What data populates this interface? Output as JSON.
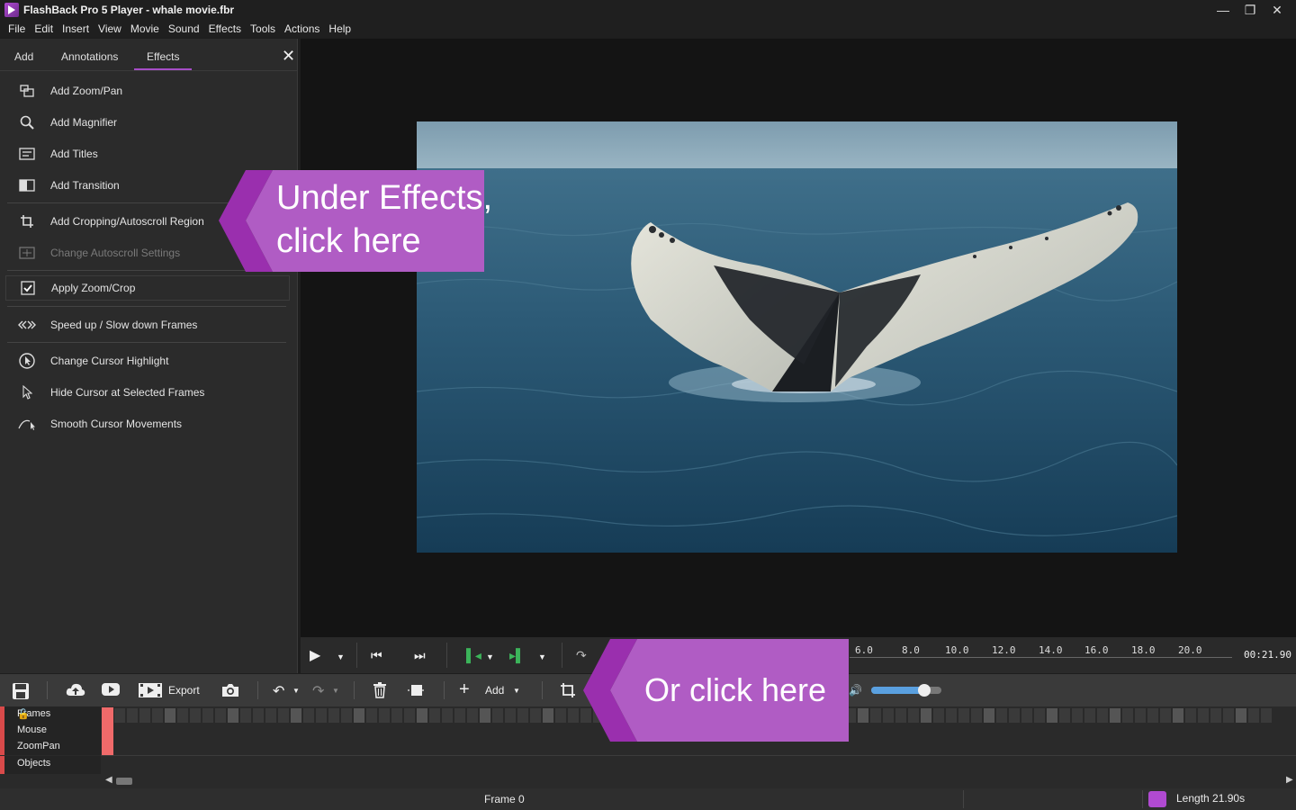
{
  "window": {
    "title": "FlashBack Pro 5 Player - whale movie.fbr",
    "minimize_glyph": "—",
    "restore_glyph": "❐",
    "close_glyph": "✕"
  },
  "menu": [
    "File",
    "Edit",
    "Insert",
    "View",
    "Movie",
    "Sound",
    "Effects",
    "Tools",
    "Actions",
    "Help"
  ],
  "panel": {
    "tabs": [
      "Add",
      "Annotations",
      "Effects"
    ],
    "active_tab": "Effects",
    "close_glyph": "✕",
    "items": [
      {
        "label": "Add Zoom/Pan",
        "icon": "zoom-pan-icon",
        "enabled": true
      },
      {
        "label": "Add Magnifier",
        "icon": "magnifier-icon",
        "enabled": true
      },
      {
        "label": "Add Titles",
        "icon": "titles-icon",
        "enabled": true
      },
      {
        "label": "Add Transition",
        "icon": "transition-icon",
        "enabled": true
      },
      {
        "label": "Add Cropping/Autoscroll Region",
        "icon": "crop-icon",
        "enabled": true
      },
      {
        "label": "Change Autoscroll Settings",
        "icon": "autoscroll-icon",
        "enabled": false
      },
      {
        "label": "Apply Zoom/Crop",
        "icon": "checkbox-icon",
        "enabled": true
      },
      {
        "label": "Speed up / Slow down Frames",
        "icon": "speed-icon",
        "enabled": true
      },
      {
        "label": "Change Cursor Highlight",
        "icon": "cursor-highlight-icon",
        "enabled": true
      },
      {
        "label": "Hide Cursor at Selected Frames",
        "icon": "cursor-icon",
        "enabled": true
      },
      {
        "label": "Smooth Cursor Movements",
        "icon": "smooth-cursor-icon",
        "enabled": true
      }
    ]
  },
  "timeline_ruler": {
    "ticks": [
      "6.0",
      "8.0",
      "10.0",
      "12.0",
      "14.0",
      "16.0",
      "18.0",
      "20.0"
    ],
    "duration": "00:21.90"
  },
  "toolbar": {
    "export_label": "Export",
    "add_label": "Add",
    "volume": 0.75
  },
  "tracks": [
    "Frames",
    "Mouse",
    "ZoomPan",
    "Objects"
  ],
  "status": {
    "frame": "Frame 0",
    "length": "Length 21.90s"
  },
  "callouts": {
    "effects": "Under Effects,\nclick here",
    "toolbar": "Or click here"
  },
  "colors": {
    "accent": "#a64dc6",
    "callout": "#b05cc4",
    "callout_arrow": "#9a2fae",
    "track_marker": "#f06a6a"
  }
}
